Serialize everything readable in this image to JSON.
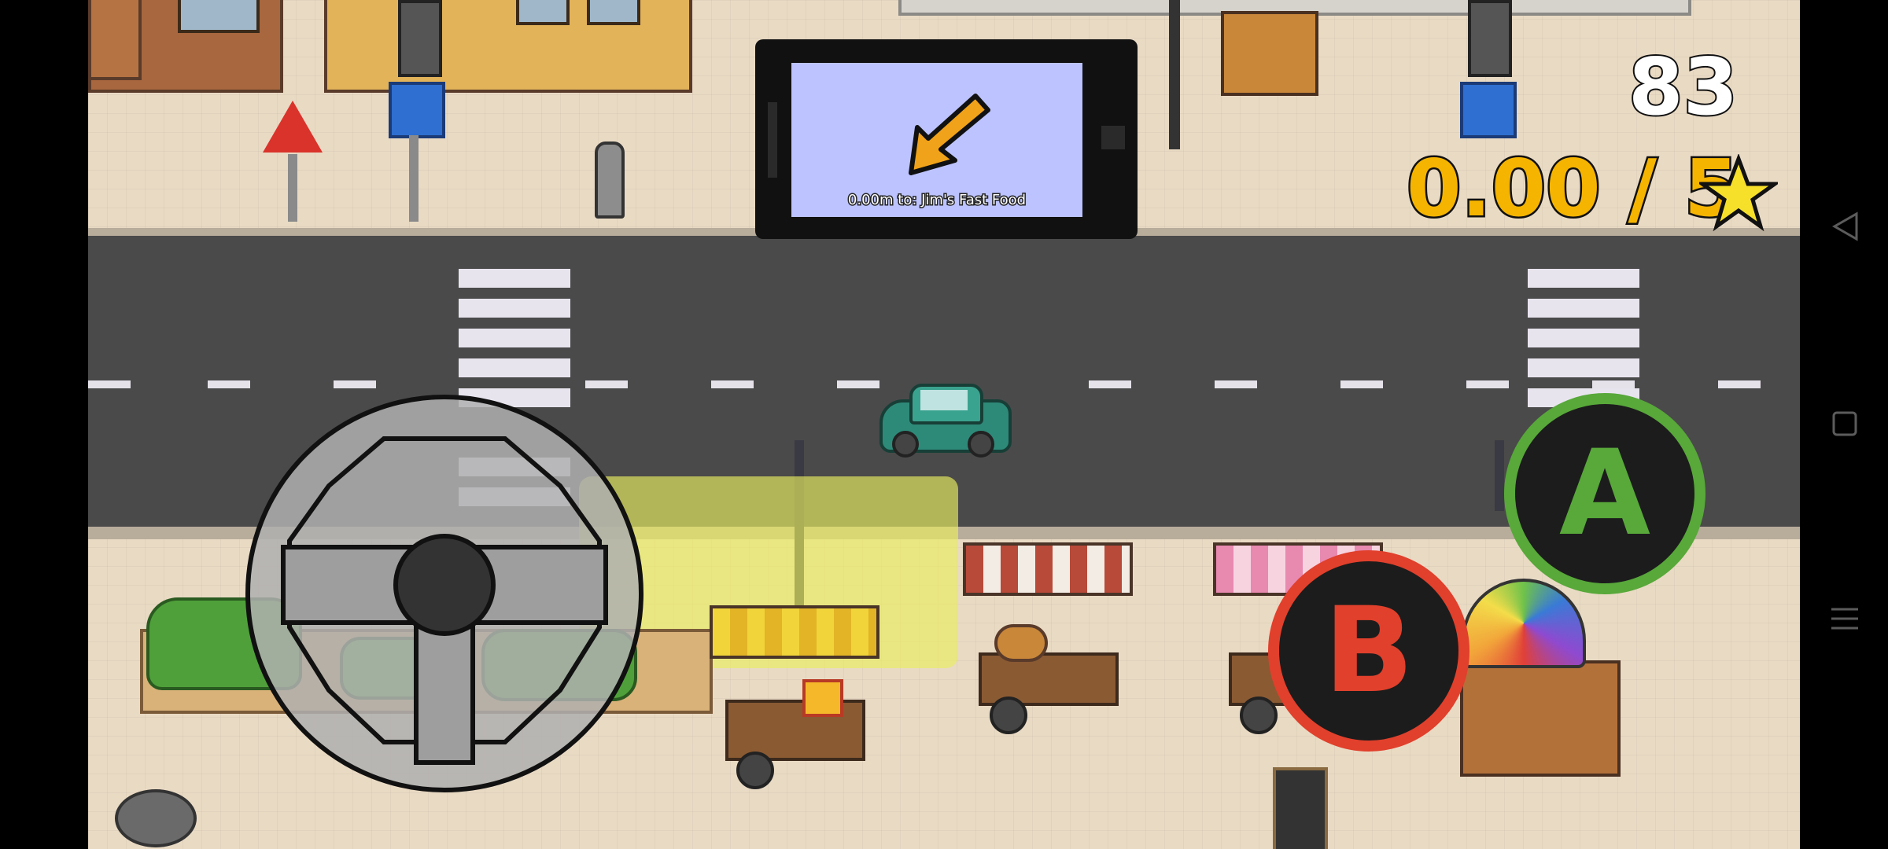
{
  "hud": {
    "timer": "83",
    "score": "0.00 / 5",
    "star_icon": "star-icon"
  },
  "navigator": {
    "distance_text": "0.00m to: Jim's Fast Food",
    "arrow_icon": "arrow-down-left-icon",
    "screen_color": "#bcc3ff",
    "arrow_color": "#f0a21a"
  },
  "controls": {
    "steering_icon": "steering-wheel-icon",
    "a_label": "A",
    "b_label": "B",
    "a_color": "#58a83a",
    "b_color": "#e0402c"
  },
  "system_nav": {
    "back_icon": "back-triangle-icon",
    "home_icon": "home-square-icon",
    "recents_icon": "recents-lines-icon"
  },
  "scene": {
    "player_car_color": "#2e8a78",
    "target_zone_color": "#e9ee60"
  }
}
